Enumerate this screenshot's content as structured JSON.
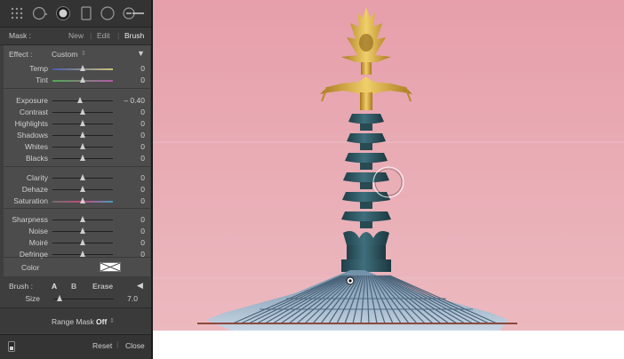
{
  "toolbar": {
    "tools": [
      "grid-tool-icon",
      "radial-filter-icon",
      "spot-removal-icon",
      "graduated-filter-icon",
      "red-eye-icon",
      "adjustment-brush-icon"
    ]
  },
  "mask": {
    "label": "Mask :",
    "options": [
      "New",
      "Edit",
      "Brush"
    ],
    "active": "Brush"
  },
  "effect": {
    "label": "Effect :",
    "value": "Custom",
    "dropdown_icon": "updown-arrow-icon",
    "collapse_icon": "triangle-down-icon"
  },
  "sliders": [
    {
      "id": "temp",
      "label": "Temp",
      "value": "0",
      "level": 0.5,
      "gradient": "temp"
    },
    {
      "id": "tint",
      "label": "Tint",
      "value": "0",
      "level": 0.5,
      "gradient": "tint"
    },
    {
      "id": "exposure",
      "label": "Exposure",
      "value": "– 0.40",
      "level": 0.45
    },
    {
      "id": "contrast",
      "label": "Contrast",
      "value": "0",
      "level": 0.5
    },
    {
      "id": "highlights",
      "label": "Highlights",
      "value": "0",
      "level": 0.5
    },
    {
      "id": "shadows",
      "label": "Shadows",
      "value": "0",
      "level": 0.5
    },
    {
      "id": "whites",
      "label": "Whites",
      "value": "0",
      "level": 0.5
    },
    {
      "id": "blacks",
      "label": "Blacks",
      "value": "0",
      "level": 0.5
    },
    {
      "id": "clarity",
      "label": "Clarity",
      "value": "0",
      "level": 0.5
    },
    {
      "id": "dehaze",
      "label": "Dehaze",
      "value": "0",
      "level": 0.5
    },
    {
      "id": "saturation",
      "label": "Saturation",
      "value": "0",
      "level": 0.5,
      "gradient": "sat"
    },
    {
      "id": "sharpness",
      "label": "Sharpness",
      "value": "0",
      "level": 0.5
    },
    {
      "id": "noise",
      "label": "Noise",
      "value": "0",
      "level": 0.5
    },
    {
      "id": "moire",
      "label": "Moiré",
      "value": "0",
      "level": 0.5
    },
    {
      "id": "defringe",
      "label": "Defringe",
      "value": "0",
      "level": 0.5
    }
  ],
  "color": {
    "label": "Color",
    "swatch_icon": "no-color-swatch-icon"
  },
  "brush": {
    "label": "Brush :",
    "options": [
      "A",
      "B",
      "Erase"
    ],
    "collapse_icon": "triangle-left-icon",
    "size_label": "Size",
    "size_value": "7.0",
    "size_level": 0.1
  },
  "range_mask": {
    "label": "Range Mask :",
    "value": "Off",
    "dropdown_icon": "updown-arrow-icon"
  },
  "footer": {
    "toggle_icon": "mask-toggle-icon",
    "reset": "Reset",
    "close": "Close"
  },
  "colors": {
    "panel_bg": "#3e3e3e",
    "sky_top": "#e7a3ad",
    "sky_bottom": "#eab7bd",
    "teal": "#2f5a66",
    "gold": "#c79a33"
  }
}
